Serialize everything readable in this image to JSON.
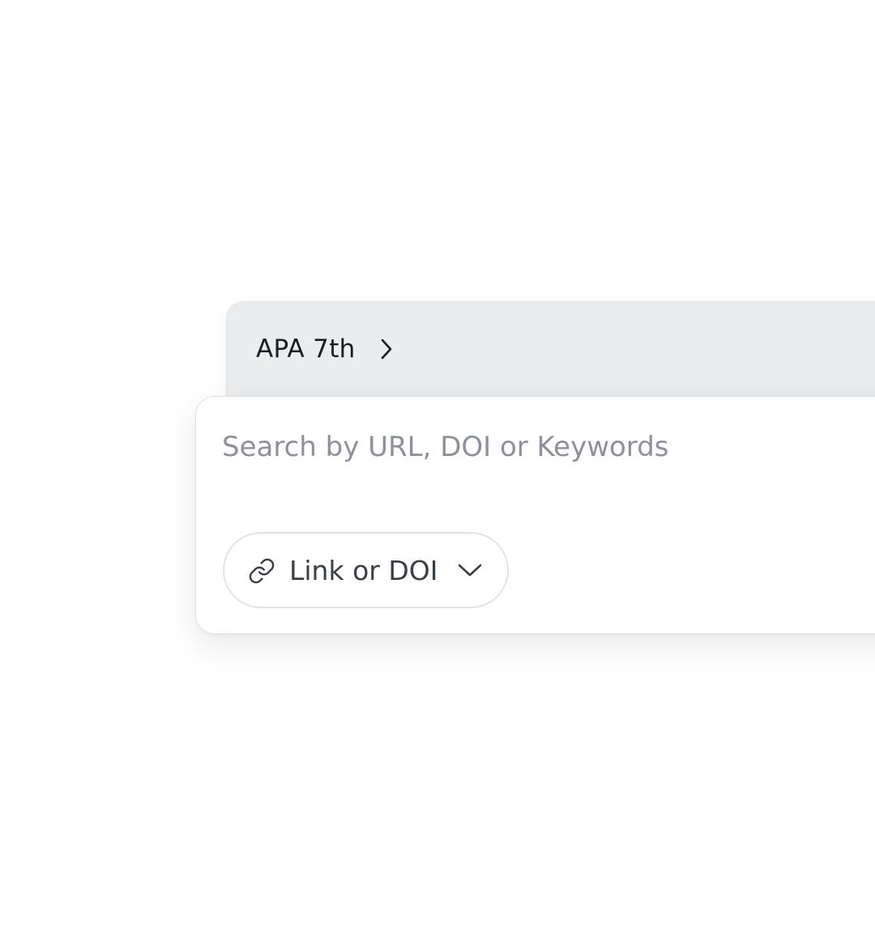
{
  "citation_style": {
    "label": "APA 7th",
    "chevron_icon": "chevron-right-icon"
  },
  "search": {
    "placeholder": "Search by URL, DOI or Keywords",
    "value": ""
  },
  "source_type": {
    "label": "Link or DOI",
    "icon": "link-icon",
    "dropdown_icon": "chevron-down-icon"
  },
  "colors": {
    "tab_background": "#ebecee",
    "card_background": "#ffffff",
    "placeholder_text": "#8d919b",
    "primary_text": "#1b1d22",
    "pill_border": "#e3e4e7"
  }
}
